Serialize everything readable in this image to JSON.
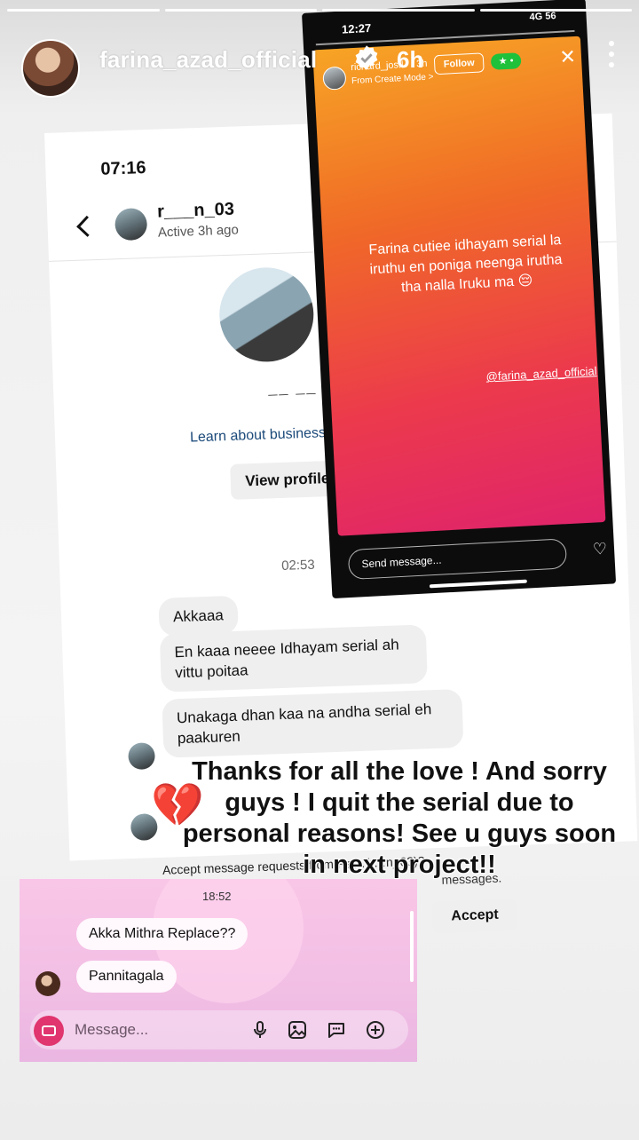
{
  "story": {
    "username": "farina_azad_official",
    "time_ago": "6h",
    "progress_bar_count": 4
  },
  "dm": {
    "clock": "07:16",
    "username": "r___n_03",
    "active": "Active 3h ago",
    "profile_name": "__ __",
    "learn_link": "Learn about business chats",
    "view_profile_label": "View profile",
    "timestamp": "02:53",
    "messages": [
      "Akkaaa",
      "En kaaa neeee  Idhayam serial ah vittu poitaa",
      "Unakaga dhan kaa na andha serial eh paakuren"
    ],
    "accept_text": "Accept message requests from Ra…(r…n_03)?",
    "messages_word": "messages.",
    "accept_label": "Accept"
  },
  "phone": {
    "clock": "12:27",
    "status": "4G 56",
    "username": "richard_jos.l",
    "time": "3h",
    "mode": "From Create Mode >",
    "follow_label": "Follow",
    "star_label": "★ •",
    "story_text": "Farina cutiee idhayam serial la iruthu en poniga neenga irutha tha nalla Iruku ma 😔",
    "mention": "@farina_azad_official",
    "send_placeholder": "Send message..."
  },
  "pink_chat": {
    "time": "18:52",
    "messages": [
      "Akka Mithra Replace??",
      "Pannitagala"
    ],
    "input_placeholder": "Message..."
  },
  "caption": "Thanks for all the love ! And sorry guys ! I quit the serial due to personal reasons! See u guys soon in next project!!",
  "colors": {
    "camera_button": "#e0356e",
    "story_gradient_top": "#f7a425",
    "story_gradient_bottom": "#e0246a",
    "verified_badge": "#ffffff",
    "broken_heart": "#d81b2a"
  }
}
